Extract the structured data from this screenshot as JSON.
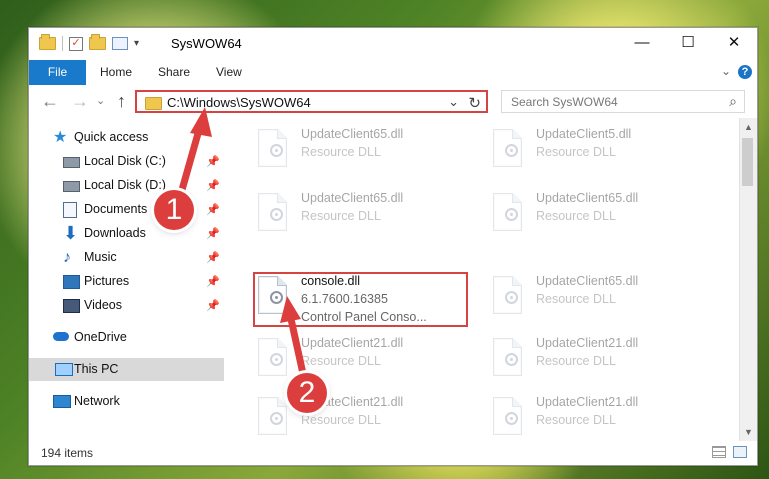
{
  "window": {
    "title": "SysWOW64",
    "controls": {
      "minimize": "—",
      "maximize": "☐",
      "close": "✕"
    }
  },
  "ribbon": {
    "tabs": [
      "File",
      "Home",
      "Share",
      "View"
    ]
  },
  "navigation": {
    "back": "←",
    "forward": "→",
    "recent": "⌄",
    "up": "↑",
    "address": "C:\\Windows\\SysWOW64",
    "dropdown": "⌄",
    "refresh": "↻",
    "search_placeholder": "Search SysWOW64",
    "search_icon": "⌕"
  },
  "sidebar": {
    "items": [
      {
        "label": "Quick access"
      },
      {
        "label": "Local Disk (C:)"
      },
      {
        "label": "Local Disk (D:)"
      },
      {
        "label": "Documents"
      },
      {
        "label": "Downloads"
      },
      {
        "label": "Music"
      },
      {
        "label": "Pictures"
      },
      {
        "label": "Videos"
      },
      {
        "label": "OneDrive"
      },
      {
        "label": "This PC"
      },
      {
        "label": "Network"
      }
    ]
  },
  "files": {
    "items": [
      {
        "name": "UpdateClient65.dll",
        "desc": "Resource DLL"
      },
      {
        "name": "UpdateClient5.dll",
        "desc": "Resource DLL"
      },
      {
        "name": "UpdateClient65.dll",
        "desc": "Resource DLL"
      },
      {
        "name": "UpdateClient65.dll",
        "desc": "Resource DLL"
      },
      {
        "name": "console.dll",
        "version": "6.1.7600.16385",
        "type": "Control Panel Conso..."
      },
      {
        "name": "UpdateClient65.dll",
        "desc": "Resource DLL"
      },
      {
        "name": "UpdateClient21.dll",
        "desc": "Resource DLL"
      },
      {
        "name": "UpdateClient21.dll",
        "desc": "Resource DLL"
      },
      {
        "name": "UpdateClient21.dll",
        "desc": "Resource DLL"
      },
      {
        "name": "UpdateClient21.dll",
        "desc": "Resource DLL"
      }
    ]
  },
  "status": {
    "items_count": "194 items"
  },
  "callouts": {
    "one": "1",
    "two": "2"
  }
}
